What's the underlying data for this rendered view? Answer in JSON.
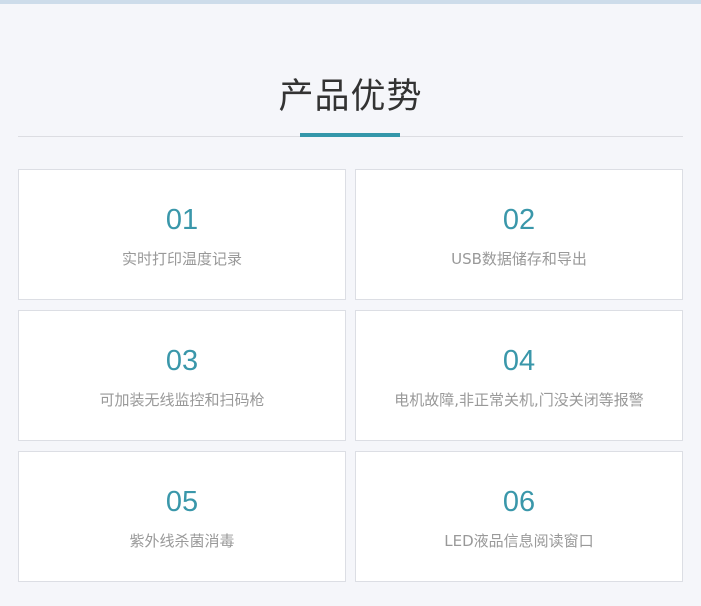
{
  "section": {
    "title": "产品优势",
    "accent_color": "#3497aa"
  },
  "features": [
    {
      "number": "01",
      "label": "实时打印温度记录"
    },
    {
      "number": "02",
      "label": "USB数据储存和导出"
    },
    {
      "number": "03",
      "label": "可加装无线监控和扫码枪"
    },
    {
      "number": "04",
      "label": "电机故障,非正常关机,门没关闭等报警"
    },
    {
      "number": "05",
      "label": "紫外线杀菌消毒"
    },
    {
      "number": "06",
      "label": "LED液品信息阅读窗口"
    }
  ]
}
